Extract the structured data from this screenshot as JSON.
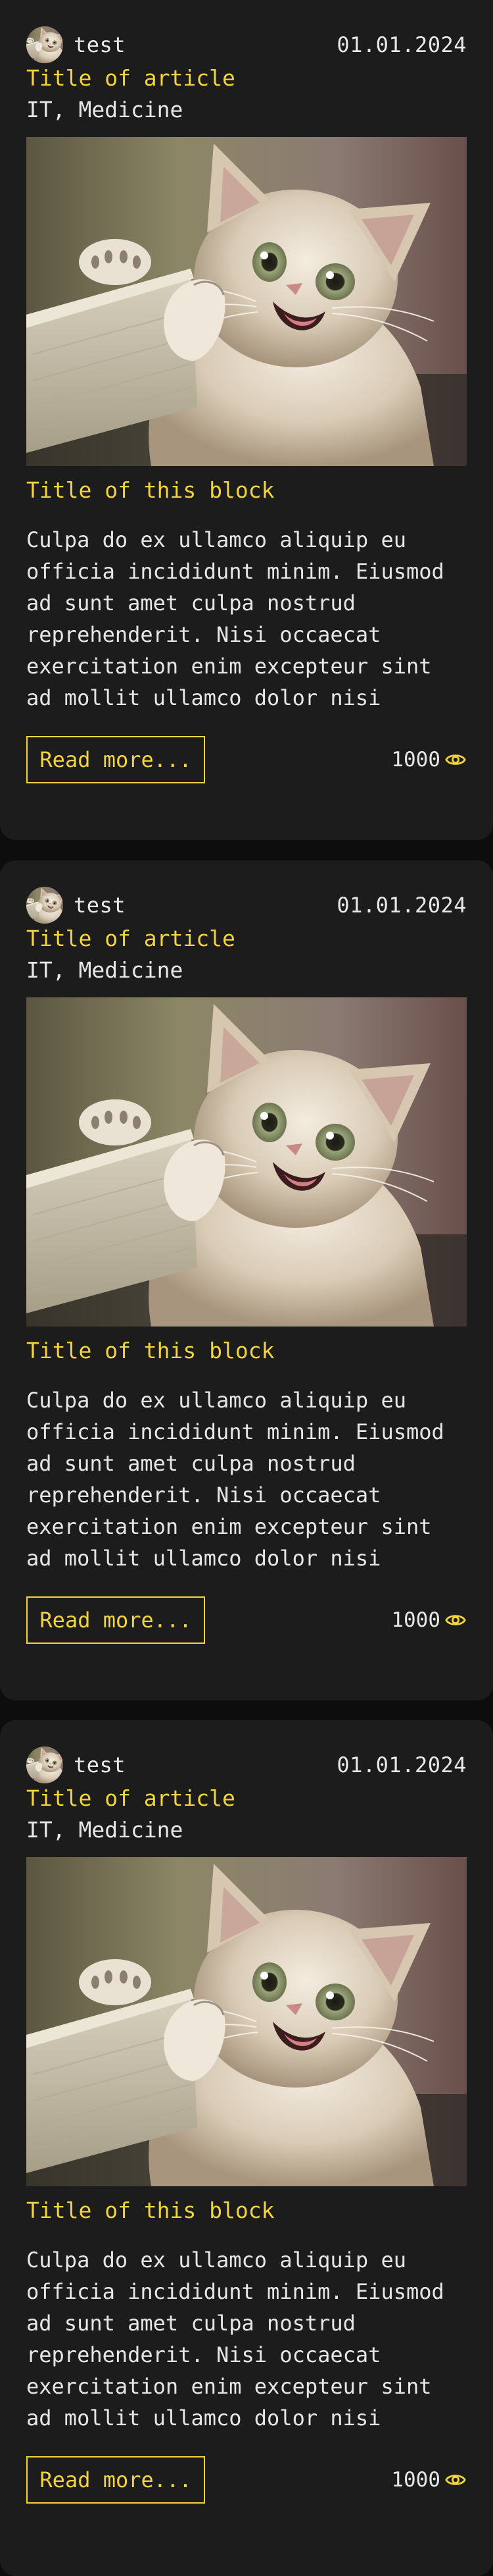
{
  "posts": [
    {
      "author": "test",
      "date": "01.01.2024",
      "article_title": "Title of article",
      "tags": "IT, Medicine",
      "block_title": "Title of this block",
      "body": "Culpa do ex ullamco aliquip eu officia incididunt minim. Eiusmod ad sunt amet culpa nostrud reprehenderit. Nisi occaecat exercitation enim excepteur sint ad mollit ullamco dolor nisi nulla. Nostrud cupidatat amet",
      "read_more_label": "Read more...",
      "views": "1000",
      "views_icon": "eye-icon",
      "avatar_icon": "cat-avatar",
      "image": "cat-photo"
    },
    {
      "author": "test",
      "date": "01.01.2024",
      "article_title": "Title of article",
      "tags": "IT, Medicine",
      "block_title": "Title of this block",
      "body": "Culpa do ex ullamco aliquip eu officia incididunt minim. Eiusmod ad sunt amet culpa nostrud reprehenderit. Nisi occaecat exercitation enim excepteur sint ad mollit ullamco dolor nisi nulla. Nostrud cupidatat amet",
      "read_more_label": "Read more...",
      "views": "1000",
      "views_icon": "eye-icon",
      "avatar_icon": "cat-avatar",
      "image": "cat-photo"
    },
    {
      "author": "test",
      "date": "01.01.2024",
      "article_title": "Title of article",
      "tags": "IT, Medicine",
      "block_title": "Title of this block",
      "body": "Culpa do ex ullamco aliquip eu officia incididunt minim. Eiusmod ad sunt amet culpa nostrud reprehenderit. Nisi occaecat exercitation enim excepteur sint ad mollit ullamco dolor nisi nulla. Nostrud cupidatat amet",
      "read_more_label": "Read more...",
      "views": "1000",
      "views_icon": "eye-icon",
      "avatar_icon": "cat-avatar",
      "image": "cat-photo"
    }
  ],
  "colors": {
    "page_background": "#0d0d0d",
    "card_background": "#1c1c1c",
    "accent": "#f2d43c",
    "text": "#e8e8e8"
  }
}
